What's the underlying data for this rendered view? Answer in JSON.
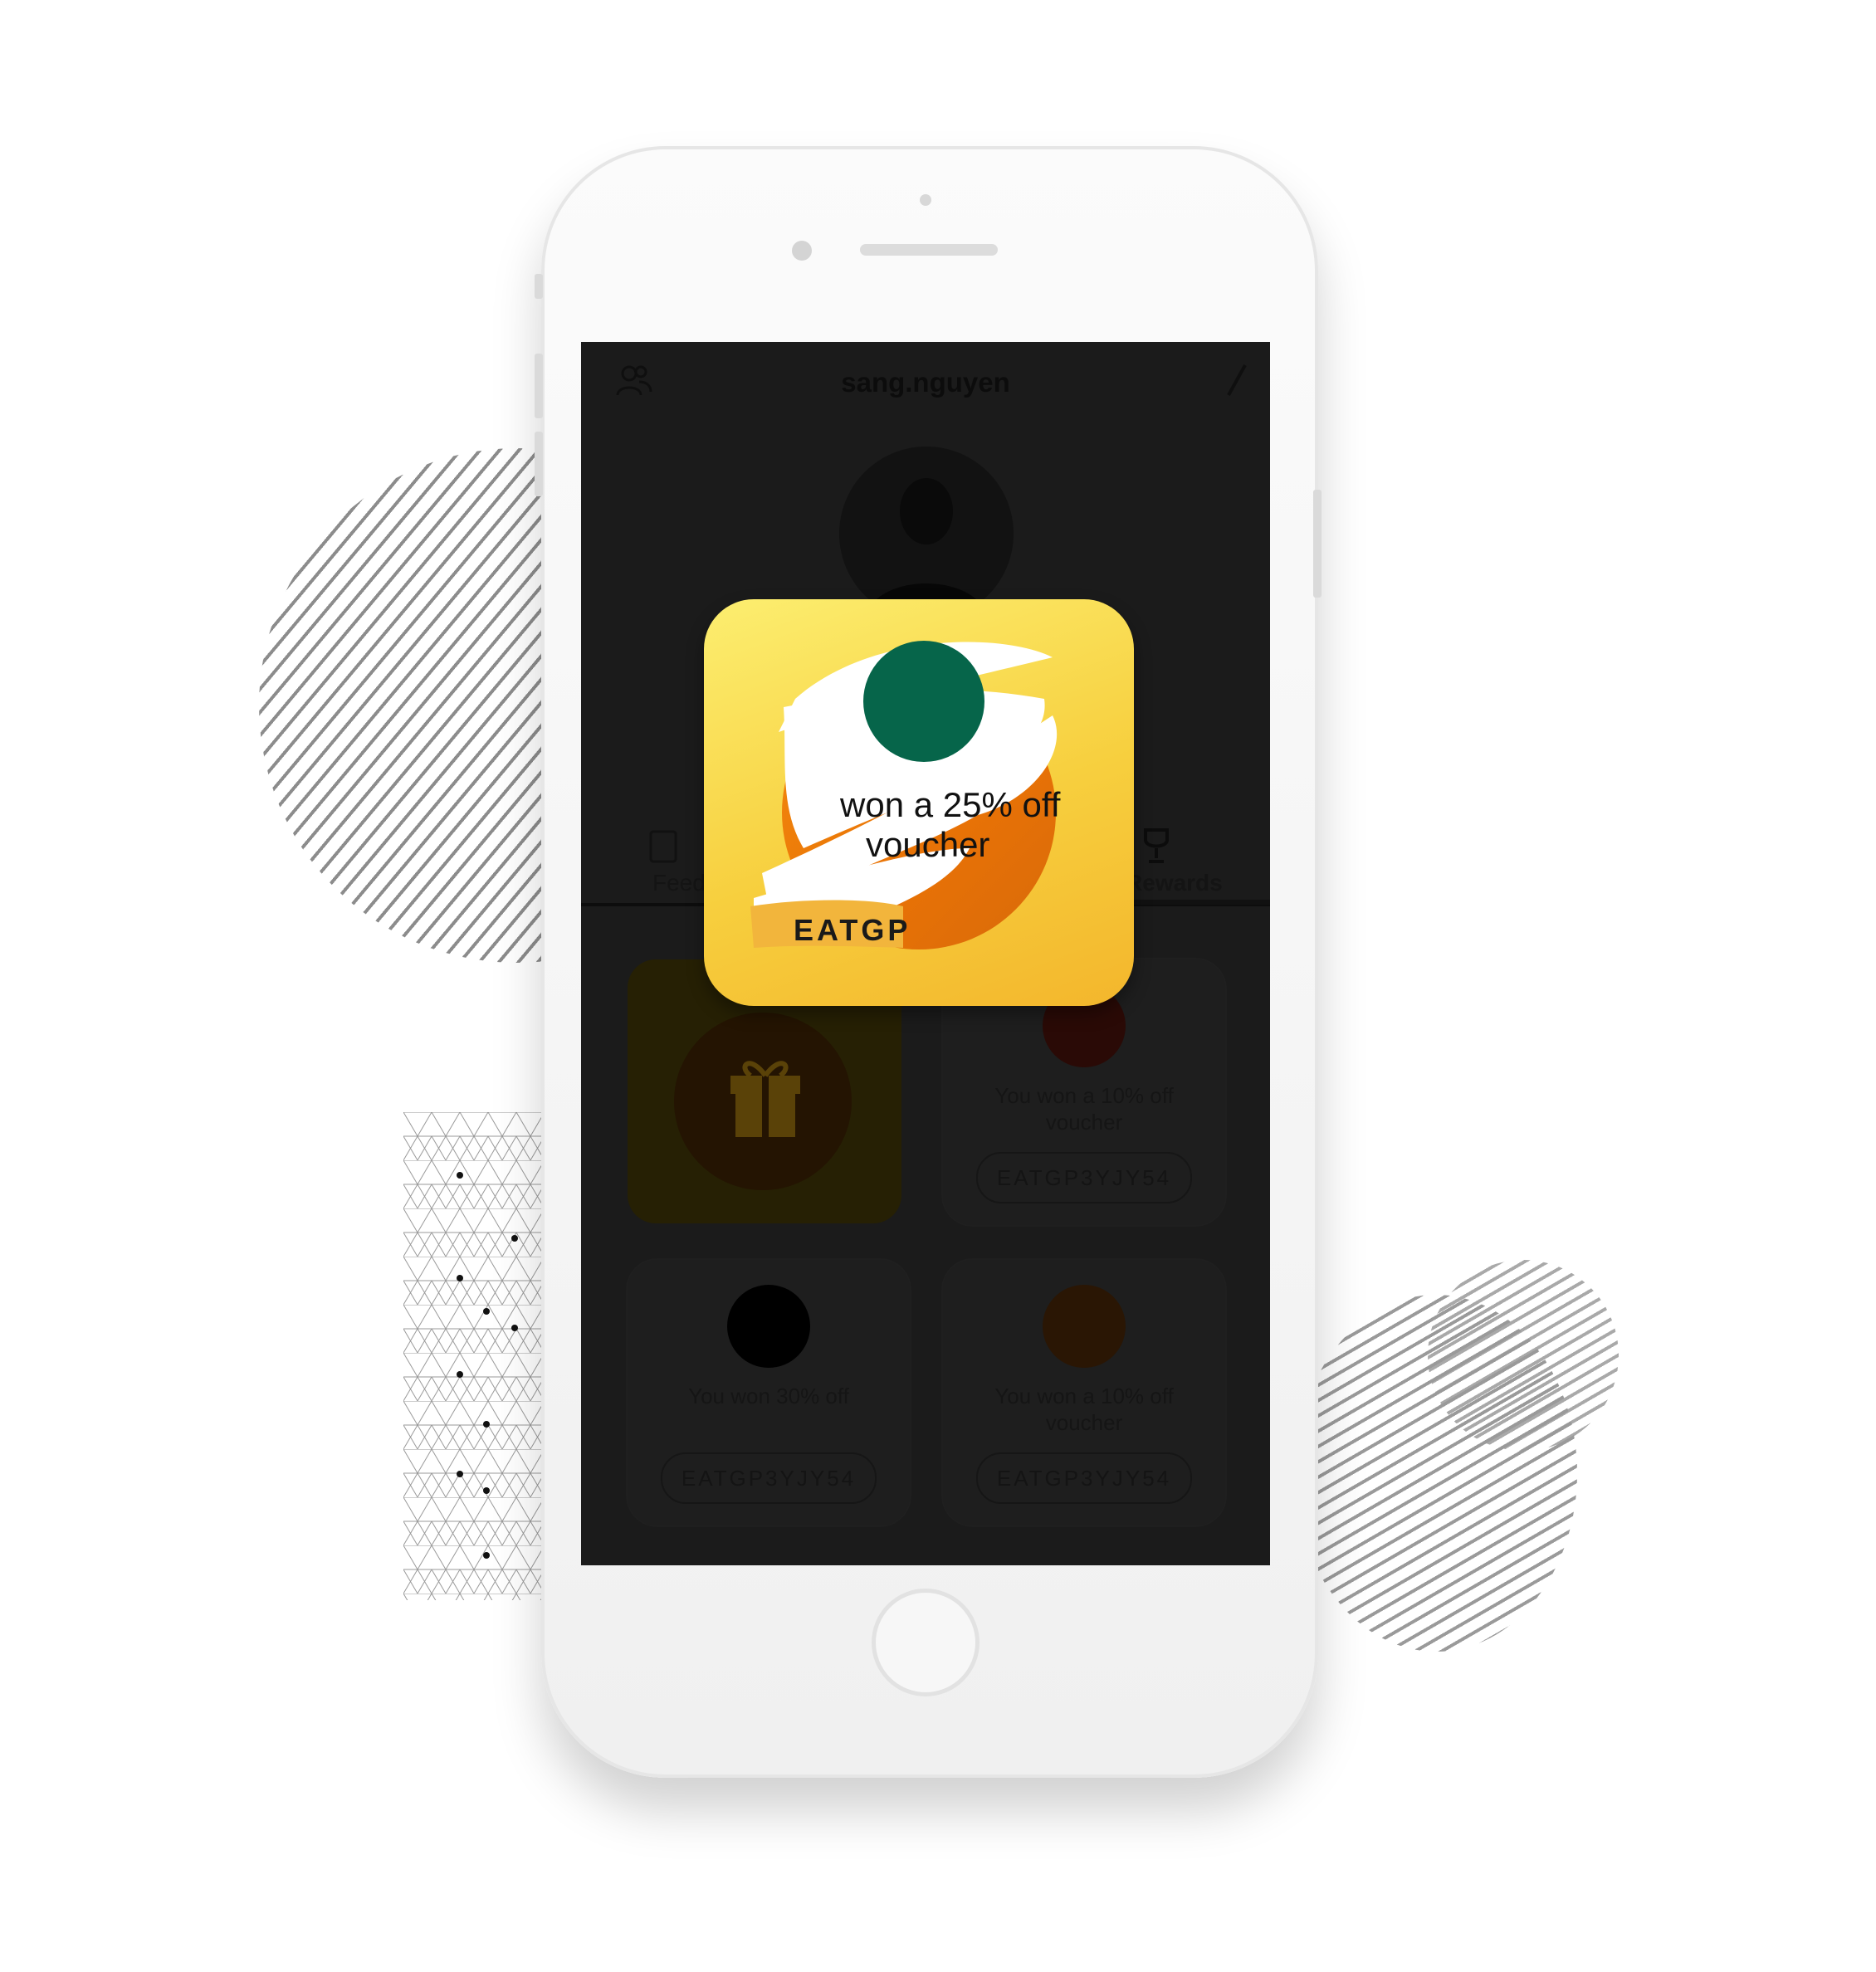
{
  "screen": {
    "username": "sang.nguyen",
    "tabs": {
      "feed_label": "Feed",
      "rewards_label": "Rewards"
    },
    "vouchers": [
      {
        "text": "You won a 10% off voucher",
        "code": "EATGP3YJY54",
        "color": "#2a0a06"
      },
      {
        "text": "You won 30% off",
        "code": "EATGP3YJY54",
        "color": "#000000"
      },
      {
        "text": "You won a 10% off voucher",
        "code": "EATGP3YJY54",
        "color": "#2a1604"
      }
    ]
  },
  "popup": {
    "line1": "won a 25% off",
    "line2": "voucher",
    "code": "EATGP",
    "colors": {
      "gold_top": "#fcee70",
      "gold_bottom": "#f3b62c",
      "orange": "#f48b0d",
      "green": "#06654a"
    }
  }
}
